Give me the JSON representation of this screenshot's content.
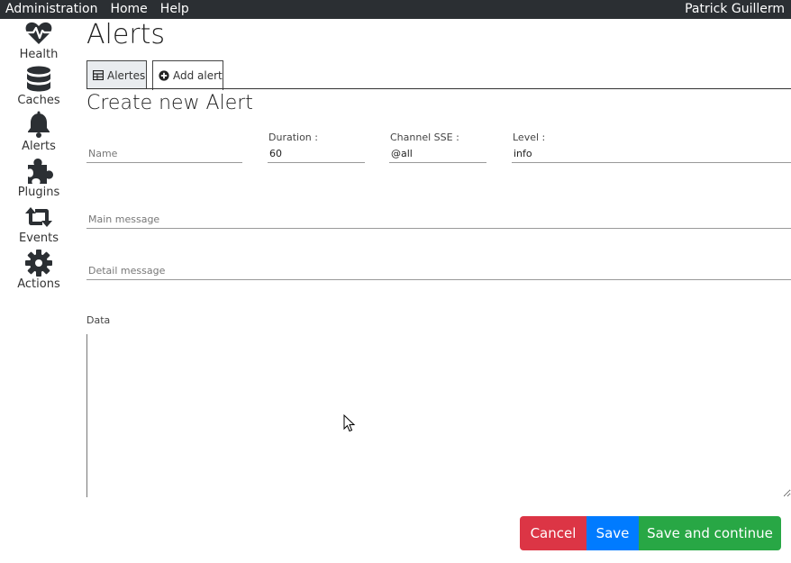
{
  "topbar": {
    "menu": [
      "Administration",
      "Home",
      "Help"
    ],
    "user": "Patrick Guillerm"
  },
  "sidebar": {
    "items": [
      {
        "label": "Health",
        "icon": "heart-pulse-icon"
      },
      {
        "label": "Caches",
        "icon": "database-icon"
      },
      {
        "label": "Alerts",
        "icon": "bell-icon"
      },
      {
        "label": "Plugins",
        "icon": "puzzle-icon"
      },
      {
        "label": "Events",
        "icon": "retweet-icon"
      },
      {
        "label": "Actions",
        "icon": "gear-icon"
      }
    ]
  },
  "page": {
    "title": "Alerts",
    "tabs": [
      {
        "label": "Alertes",
        "icon": "table-icon",
        "active": false
      },
      {
        "label": "Add alert",
        "icon": "plus-circle-icon",
        "active": true
      }
    ],
    "section_title": "Create new Alert"
  },
  "form": {
    "name": {
      "label": "",
      "placeholder": "Name",
      "value": ""
    },
    "duration": {
      "label": "Duration :",
      "value": "60"
    },
    "channel": {
      "label": "Channel SSE :",
      "value": "@all"
    },
    "level": {
      "label": "Level :",
      "value": "info"
    },
    "main_message": {
      "placeholder": "Main message",
      "value": ""
    },
    "detail_message": {
      "placeholder": "Detail message",
      "value": ""
    },
    "data": {
      "label": "Data",
      "value": ""
    }
  },
  "actions": {
    "cancel": "Cancel",
    "save": "Save",
    "save_continue": "Save and continue"
  },
  "colors": {
    "topbar": "#2b2f33",
    "cancel": "#dc3545",
    "save": "#007bff",
    "save_continue": "#28a745"
  }
}
